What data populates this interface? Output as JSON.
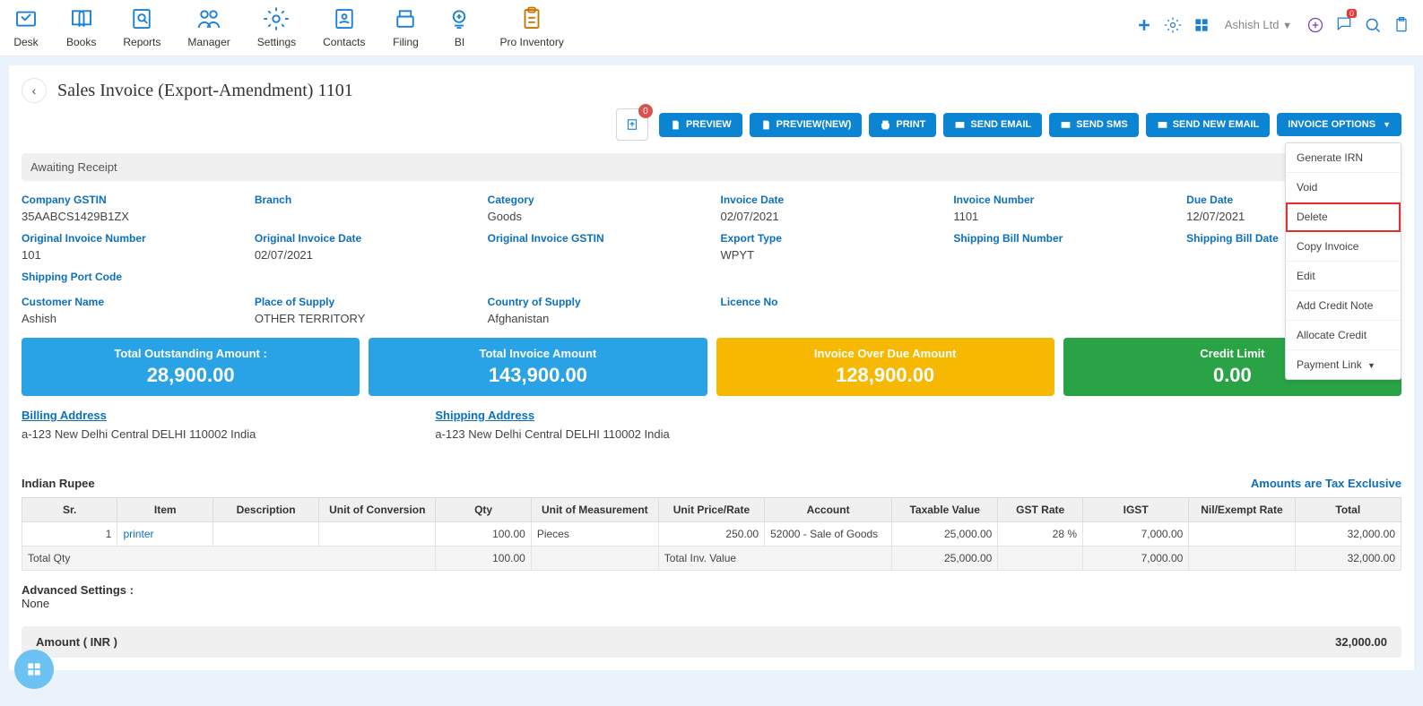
{
  "nav": {
    "items": [
      {
        "label": "Desk"
      },
      {
        "label": "Books"
      },
      {
        "label": "Reports"
      },
      {
        "label": "Manager"
      },
      {
        "label": "Settings"
      },
      {
        "label": "Contacts"
      },
      {
        "label": "Filing"
      },
      {
        "label": "BI"
      },
      {
        "label": "Pro Inventory"
      }
    ],
    "message_badge": "0",
    "company": "Ashish Ltd"
  },
  "page": {
    "title": "Sales Invoice (Export-Amendment) 1101",
    "upload_count": "0"
  },
  "buttons": {
    "preview": "PREVIEW",
    "preview_new": "PREVIEW(NEW)",
    "print": "PRINT",
    "send_email": "SEND EMAIL",
    "send_sms": "SEND SMS",
    "send_new_email": "SEND NEW EMAIL",
    "invoice_options": "INVOICE OPTIONS"
  },
  "dropdown": {
    "generate_irn": "Generate IRN",
    "void": "Void",
    "delete": "Delete",
    "copy": "Copy Invoice",
    "edit": "Edit",
    "add_credit": "Add Credit Note",
    "allocate": "Allocate Credit",
    "payment_link": "Payment Link"
  },
  "status": "Awaiting Receipt",
  "details": {
    "company_gstin": {
      "label": "Company GSTIN",
      "value": "35AABCS1429B1ZX"
    },
    "branch": {
      "label": "Branch",
      "value": ""
    },
    "category": {
      "label": "Category",
      "value": "Goods"
    },
    "invoice_date": {
      "label": "Invoice Date",
      "value": "02/07/2021"
    },
    "invoice_number": {
      "label": "Invoice Number",
      "value": "1101"
    },
    "due_date": {
      "label": "Due Date",
      "value": "12/07/2021"
    },
    "orig_inv_no": {
      "label": "Original Invoice Number",
      "value": "101"
    },
    "orig_inv_date": {
      "label": "Original Invoice Date",
      "value": "02/07/2021"
    },
    "orig_inv_gstin": {
      "label": "Original Invoice GSTIN",
      "value": ""
    },
    "export_type": {
      "label": "Export Type",
      "value": "WPYT"
    },
    "ship_bill_no": {
      "label": "Shipping Bill Number",
      "value": ""
    },
    "ship_bill_date": {
      "label": "Shipping Bill Date",
      "value": ""
    },
    "ship_port": {
      "label": "Shipping Port Code",
      "value": ""
    },
    "customer": {
      "label": "Customer Name",
      "value": "Ashish"
    },
    "place_supply": {
      "label": "Place of Supply",
      "value": "OTHER TERRITORY"
    },
    "country_supply": {
      "label": "Country of Supply",
      "value": "Afghanistan"
    },
    "licence": {
      "label": "Licence No",
      "value": ""
    }
  },
  "summary": {
    "outstanding": {
      "label": "Total Outstanding Amount :",
      "value": "28,900.00"
    },
    "invoice_amount": {
      "label": "Total Invoice Amount",
      "value": "143,900.00"
    },
    "overdue": {
      "label": "Invoice Over Due Amount",
      "value": "128,900.00"
    },
    "credit_limit": {
      "label": "Credit Limit",
      "value": "0.00"
    }
  },
  "addresses": {
    "billing": {
      "label": "Billing Address",
      "value": "a-123 New Delhi Central DELHI 110002 India"
    },
    "shipping": {
      "label": "Shipping Address",
      "value": "a-123 New Delhi Central DELHI 110002 India"
    }
  },
  "currency": {
    "name": "Indian Rupee",
    "tax_note": "Amounts are Tax Exclusive"
  },
  "table": {
    "headers": {
      "sr": "Sr.",
      "item": "Item",
      "desc": "Description",
      "uoc": "Unit of Conversion",
      "qty": "Qty",
      "uom": "Unit of Measurement",
      "rate": "Unit Price/Rate",
      "account": "Account",
      "taxable": "Taxable Value",
      "gst": "GST Rate",
      "igst": "IGST",
      "nil": "Nil/Exempt Rate",
      "total": "Total"
    },
    "row": {
      "sr": "1",
      "item": "printer",
      "desc": "",
      "uoc": "",
      "qty": "100.00",
      "uom": "Pieces",
      "rate": "250.00",
      "account": "52000 - Sale of Goods",
      "taxable": "25,000.00",
      "gst": "28 %",
      "igst": "7,000.00",
      "nil": "",
      "total": "32,000.00"
    },
    "footer": {
      "total_qty_label": "Total Qty",
      "qty": "100.00",
      "inv_val_label": "Total Inv. Value",
      "taxable": "25,000.00",
      "igst": "7,000.00",
      "total": "32,000.00"
    }
  },
  "advanced": {
    "label": "Advanced Settings :",
    "value": "None"
  },
  "bottom": {
    "label": "Amount ( INR )",
    "value": "32,000.00"
  }
}
